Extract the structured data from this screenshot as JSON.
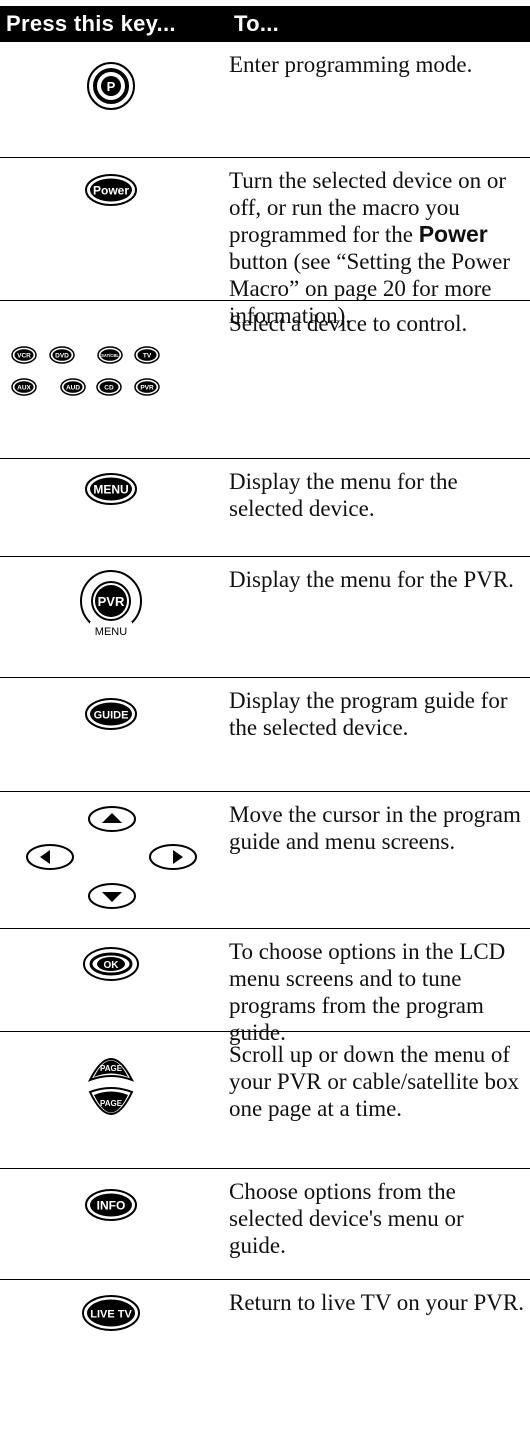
{
  "header": {
    "col1": "Press this key...",
    "col2": "To..."
  },
  "rows": [
    {
      "key": "P",
      "desc": "Enter programming mode."
    },
    {
      "key": "Power",
      "desc_pre": "Turn the selected device on or off, or run the macro you programmed for the ",
      "desc_bold": "Power",
      "desc_post": " button (see “Setting the Power Macro” on page 20 for more information)."
    },
    {
      "keys": [
        "VCR",
        "DVD",
        "SAT/CBL",
        "TV",
        "AUX",
        "AUD",
        "CD",
        "PVR"
      ],
      "desc": "Select a device to control."
    },
    {
      "key": "MENU",
      "desc": "Display the menu for the selected device."
    },
    {
      "key": "PVR",
      "key_sub": "MENU",
      "desc": "Display the menu for the PVR."
    },
    {
      "key": "GUIDE",
      "desc": "Display the program guide for the selected device."
    },
    {
      "key": "arrows",
      "desc": "Move the cursor in the program guide and menu screens."
    },
    {
      "key": "OK",
      "desc": "To choose options in the LCD menu screens and to tune programs from the program guide."
    },
    {
      "key": "PAGE",
      "desc": "Scroll up or down the menu of your PVR or cable/satellite box one page at a time."
    },
    {
      "key": "INFO",
      "desc": "Choose options from the selected device's menu or guide."
    },
    {
      "key": "LIVE TV",
      "desc": "Return to live TV on your PVR."
    }
  ]
}
